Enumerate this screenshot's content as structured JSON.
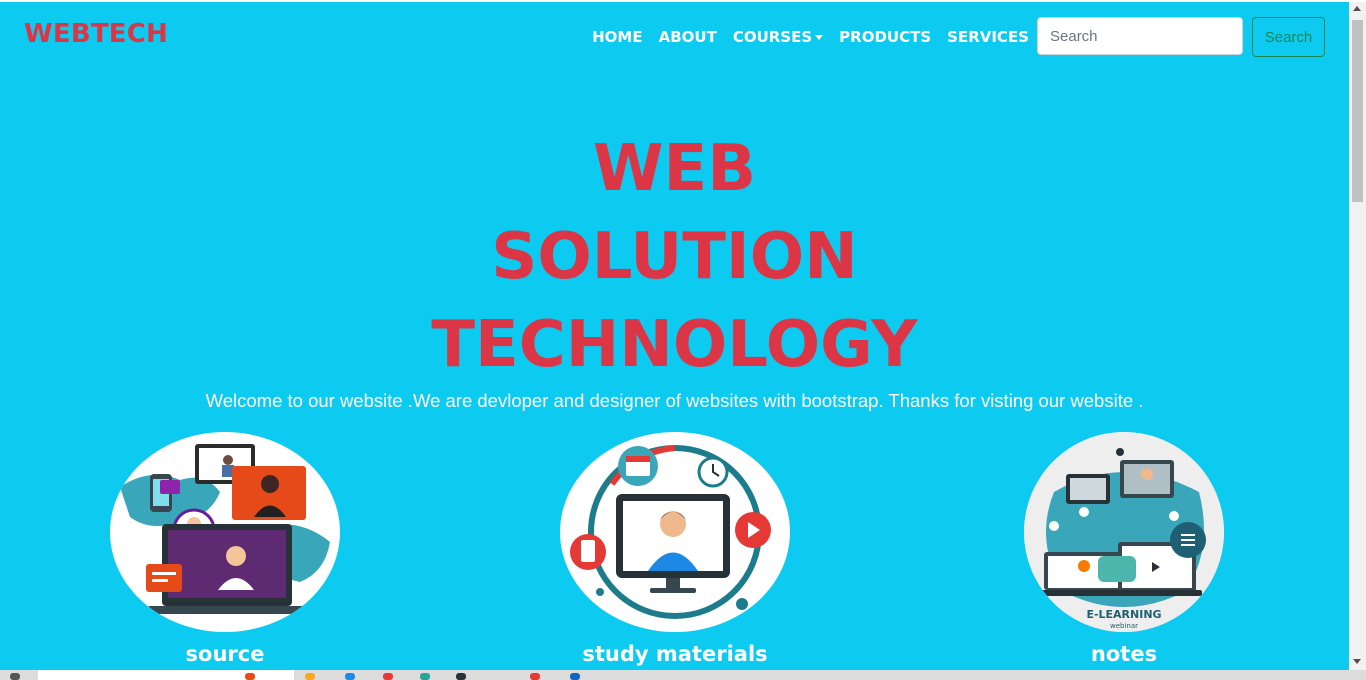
{
  "brand": "WEBTECH",
  "nav": {
    "items": [
      {
        "label": "HOME",
        "dropdown": false
      },
      {
        "label": "ABOUT",
        "dropdown": false
      },
      {
        "label": "COURSES",
        "dropdown": true
      },
      {
        "label": "PRODUCTS",
        "dropdown": false
      },
      {
        "label": "SERVICES",
        "dropdown": false
      }
    ]
  },
  "search": {
    "placeholder": "Search",
    "button_label": "Search"
  },
  "hero": {
    "lines": [
      "WEB",
      "SOLUTION",
      "TECHNOLOGY"
    ],
    "welcome": "Welcome to our website .We are devloper and designer of websites with bootstrap. Thanks for visting our website ."
  },
  "cards": [
    {
      "label": "source"
    },
    {
      "label": "study materials"
    },
    {
      "label": "notes",
      "image_caption": "E-LEARNING",
      "image_subcaption": "webinar"
    }
  ],
  "colors": {
    "background": "#0dcaf0",
    "brand": "#dc3545",
    "search_button": "#198754"
  }
}
